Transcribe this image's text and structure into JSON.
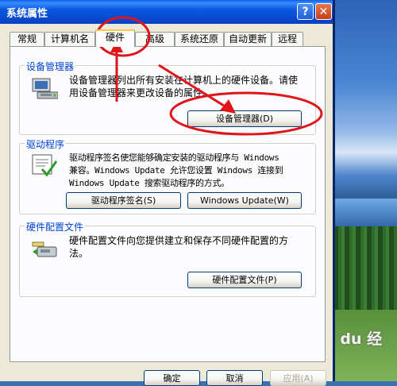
{
  "window": {
    "title": "系统属性",
    "help_glyph": "?",
    "close_glyph": "✕"
  },
  "tabs": [
    {
      "label": "常规"
    },
    {
      "label": "计算机名"
    },
    {
      "label": "硬件"
    },
    {
      "label": "高级"
    },
    {
      "label": "系统还原"
    },
    {
      "label": "自动更新"
    },
    {
      "label": "远程"
    }
  ],
  "device_manager": {
    "legend": "设备管理器",
    "line1": "设备管理器列出所有安装在计算机上的硬件设备。请使",
    "line2": "用设备管理器来更改设备的属性。",
    "button": "设备管理器(D)"
  },
  "drivers": {
    "legend": "驱动程序",
    "line1": "驱动程序签名使您能够确定安装的驱动程序与 Windows",
    "line2": "兼容。Windows Update 允许您设置 Windows 连接到",
    "line3": "Windows Update 搜索驱动程序的方式。",
    "button_signing": "驱动程序签名(S)",
    "button_update": "Windows Update(W)"
  },
  "hw_profiles": {
    "legend": "硬件配置文件",
    "line1": "硬件配置文件向您提供建立和保存不同硬件配置的方",
    "line2": "法。",
    "button": "硬件配置文件(P)"
  },
  "footer": {
    "ok": "确定",
    "cancel": "取消",
    "apply": "应用(A)"
  },
  "desktop": {
    "watermark": "Bai du 经验"
  }
}
